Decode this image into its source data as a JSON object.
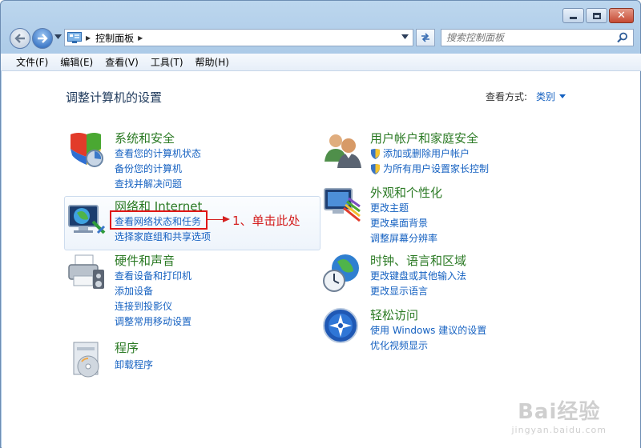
{
  "window": {
    "address_path": "控制面板",
    "search_placeholder": "搜索控制面板"
  },
  "menu": [
    "文件(F)",
    "编辑(E)",
    "查看(V)",
    "工具(T)",
    "帮助(H)"
  ],
  "page": {
    "title": "调整计算机的设置",
    "view_label": "查看方式:",
    "view_value": "类别"
  },
  "categories": {
    "system": {
      "heading": "系统和安全",
      "links": [
        "查看您的计算机状态",
        "备份您的计算机",
        "查找并解决问题"
      ]
    },
    "network": {
      "heading": "网络和 Internet",
      "links": [
        "查看网络状态和任务",
        "选择家庭组和共享选项"
      ]
    },
    "hardware": {
      "heading": "硬件和声音",
      "links": [
        "查看设备和打印机",
        "添加设备",
        "连接到投影仪",
        "调整常用移动设置"
      ]
    },
    "programs": {
      "heading": "程序",
      "links": [
        "卸载程序"
      ]
    },
    "users": {
      "heading": "用户帐户和家庭安全",
      "links": [
        "添加或删除用户帐户",
        "为所有用户设置家长控制"
      ]
    },
    "appearance": {
      "heading": "外观和个性化",
      "links": [
        "更改主题",
        "更改桌面背景",
        "调整屏幕分辨率"
      ]
    },
    "clock": {
      "heading": "时钟、语言和区域",
      "links": [
        "更改键盘或其他输入法",
        "更改显示语言"
      ]
    },
    "access": {
      "heading": "轻松访问",
      "links": [
        "使用 Windows 建议的设置",
        "优化视频显示"
      ]
    }
  },
  "annotation": "1、单击此处",
  "watermark": {
    "main": "Bai经验",
    "sub": "jingyan.baidu.com"
  }
}
